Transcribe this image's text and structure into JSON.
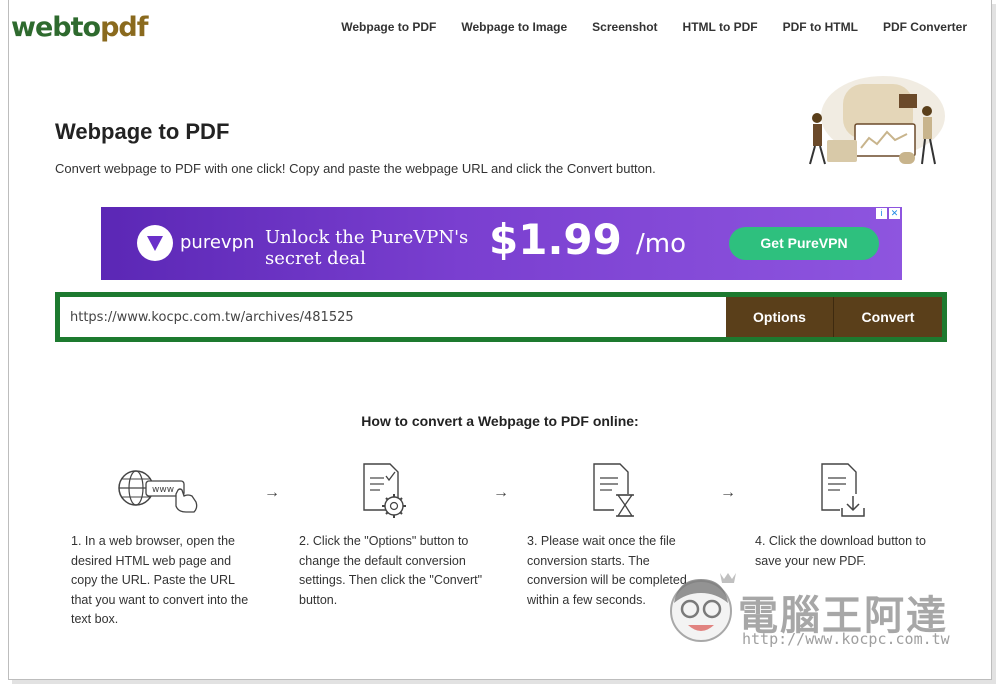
{
  "header": {
    "logo": {
      "part1": "web",
      "part2": "to",
      "part3": "pdf"
    },
    "nav": [
      {
        "label": "Webpage to PDF"
      },
      {
        "label": "Webpage to Image"
      },
      {
        "label": "Screenshot"
      },
      {
        "label": "HTML to PDF"
      },
      {
        "label": "PDF to HTML"
      },
      {
        "label": "PDF Converter"
      }
    ]
  },
  "hero": {
    "title": "Webpage to PDF",
    "subtitle": "Convert webpage to PDF with one click! Copy and paste the webpage URL and click the Convert button."
  },
  "ad": {
    "brand": "purevpn",
    "headline": "Unlock the PureVPN's secret deal",
    "price": "$1.99",
    "period": "/mo",
    "cta": "Get PureVPN",
    "badge_info": "i",
    "badge_close": "✕"
  },
  "converter": {
    "url_value": "https://www.kocpc.com.tw/archives/481525",
    "options_label": "Options",
    "convert_label": "Convert"
  },
  "howto": {
    "title": "How to convert a Webpage to PDF online:",
    "icon_www_text": "www",
    "arrow": "→",
    "steps": [
      {
        "text": "1. In a web browser, open the desired HTML web page and copy the URL. Paste the URL that you want to convert into the text box.",
        "icon": "browser-www-icon"
      },
      {
        "text": "2. Click the \"Options\" button to change the default conversion settings. Then click the \"Convert\" button.",
        "icon": "document-settings-icon"
      },
      {
        "text": "3. Please wait once the file conversion starts. The conversion will be completed within a few seconds.",
        "icon": "document-hourglass-icon"
      },
      {
        "text": "4. Click the download button to save your new PDF.",
        "icon": "document-download-icon"
      }
    ]
  },
  "watermark": {
    "name": "電腦王阿達",
    "url": "http://www.kocpc.com.tw"
  },
  "colors": {
    "brand_green": "#1d7a2f",
    "button_brown": "#5a3f1a",
    "ad_purple": "#6a2fc9",
    "ad_cta_green": "#2ec07e"
  }
}
